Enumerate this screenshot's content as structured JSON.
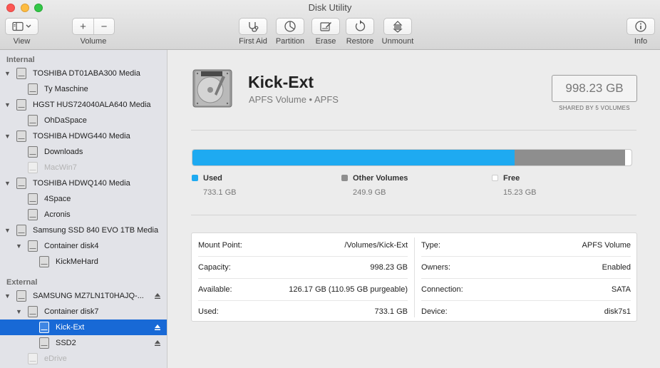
{
  "window": {
    "title": "Disk Utility"
  },
  "toolbar": {
    "view_label": "View",
    "volume_label": "Volume",
    "volume_add": "+",
    "volume_remove": "−",
    "first_aid_label": "First Aid",
    "partition_label": "Partition",
    "erase_label": "Erase",
    "restore_label": "Restore",
    "unmount_label": "Unmount",
    "info_label": "Info"
  },
  "sidebar": {
    "internal_header": "Internal",
    "external_header": "External",
    "internal_items": [
      {
        "label": "TOSHIBA DT01ABA300 Media",
        "level": 0
      },
      {
        "label": "Ty Maschine",
        "level": 1
      },
      {
        "label": "HGST HUS724040ALA640 Media",
        "level": 0
      },
      {
        "label": "OhDaSpace",
        "level": 1
      },
      {
        "label": "TOSHIBA HDWG440 Media",
        "level": 0
      },
      {
        "label": "Downloads",
        "level": 1
      },
      {
        "label": "MacWin7",
        "level": 1
      },
      {
        "label": "TOSHIBA HDWQ140 Media",
        "level": 0
      },
      {
        "label": "4Space",
        "level": 1
      },
      {
        "label": "Acronis",
        "level": 1
      },
      {
        "label": "Samsung SSD 840 EVO 1TB Media",
        "level": 0
      },
      {
        "label": "Container disk4",
        "level": 1
      },
      {
        "label": "KickMeHard",
        "level": 2
      }
    ],
    "external_items": [
      {
        "label": "SAMSUNG MZ7LN1T0HAJQ-...",
        "level": 0
      },
      {
        "label": "Container disk7",
        "level": 1
      },
      {
        "label": "Kick-Ext",
        "level": 2
      },
      {
        "label": "SSD2",
        "level": 2
      },
      {
        "label": "eDrive",
        "level": 1
      }
    ]
  },
  "volume": {
    "name": "Kick-Ext",
    "subtitle": "APFS Volume • APFS",
    "capacity_display": "998.23 GB",
    "shared_note": "SHARED BY 5 VOLUMES"
  },
  "usage": {
    "total_gb": 998.23,
    "used": {
      "label": "Used",
      "value": "733.1 GB",
      "gb": 733.1,
      "color": "#1eaaf1"
    },
    "other": {
      "label": "Other Volumes",
      "value": "249.9 GB",
      "gb": 249.9,
      "color": "#8e8e8e"
    },
    "free": {
      "label": "Free",
      "value": "15.23 GB",
      "gb": 15.23,
      "color": "#ffffff"
    }
  },
  "details": {
    "left": [
      {
        "key": "Mount Point:",
        "value": "/Volumes/Kick-Ext"
      },
      {
        "key": "Capacity:",
        "value": "998.23 GB"
      },
      {
        "key": "Available:",
        "value": "126.17 GB (110.95 GB purgeable)"
      },
      {
        "key": "Used:",
        "value": "733.1 GB"
      }
    ],
    "right": [
      {
        "key": "Type:",
        "value": "APFS Volume"
      },
      {
        "key": "Owners:",
        "value": "Enabled"
      },
      {
        "key": "Connection:",
        "value": "SATA"
      },
      {
        "key": "Device:",
        "value": "disk7s1"
      }
    ]
  },
  "colors": {
    "accent": "#1869d6",
    "used": "#1eaaf1",
    "other": "#8e8e8e"
  }
}
